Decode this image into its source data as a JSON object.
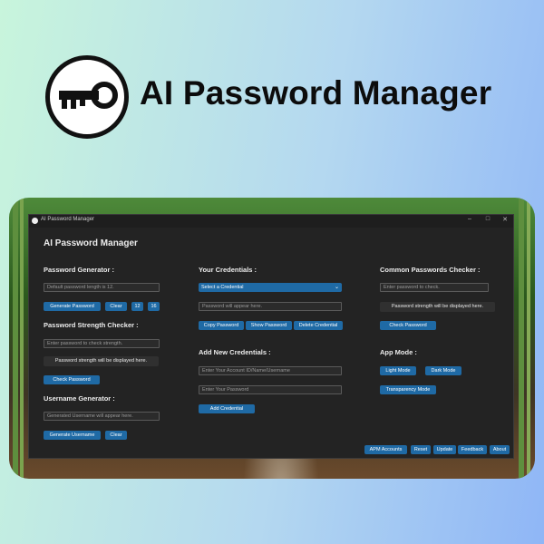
{
  "hero": {
    "title": "AI Password Manager"
  },
  "window": {
    "title": "AI Password Manager",
    "controls": {
      "minimize": "–",
      "maximize": "□",
      "close": "✕"
    },
    "app_title": "AI Password Manager"
  },
  "password_generator": {
    "heading": "Password Generator :",
    "field_placeholder": "Default password length is 12.",
    "generate": "Generate Password",
    "clear": "Clear",
    "len12": "12",
    "len16": "16"
  },
  "strength_checker": {
    "heading": "Password Strength Checker :",
    "field_placeholder": "Enter password to check strength.",
    "result": "Password strength will be displayed here.",
    "check": "Check Password"
  },
  "username_generator": {
    "heading": "Username Generator :",
    "field_placeholder": "Generated Username will appear here.",
    "generate": "Generate Username",
    "clear": "Clear"
  },
  "credentials": {
    "heading": "Your Credentials :",
    "select_value": "Select a Credential",
    "password_placeholder": "Password will appear here.",
    "copy": "Copy Password",
    "show": "Show Password",
    "delete": "Delete Credential"
  },
  "add_credentials": {
    "heading": "Add New Credentials :",
    "account_placeholder": "Enter Your Account ID/Name/Username",
    "password_placeholder": "Enter Your Password",
    "add": "Add Credential"
  },
  "common_checker": {
    "heading": "Common Passwords Checker :",
    "field_placeholder": "Enter password to check.",
    "result": "Password strength will be displayed here.",
    "check": "Check Password"
  },
  "app_mode": {
    "heading": "App Mode :",
    "light": "Light Mode",
    "dark": "Dark Mode",
    "transparency": "Transparency Mode"
  },
  "footer": {
    "apm_accounts": "APM Accounts",
    "reset": "Reset",
    "update": "Update",
    "feedback": "Feedback",
    "about": "About"
  },
  "colors": {
    "accent": "#1f6aa5",
    "window_bg": "#232323",
    "text": "#ececec"
  },
  "icons": {
    "logo": "key-icon",
    "app_icon": "app-logo-icon"
  }
}
